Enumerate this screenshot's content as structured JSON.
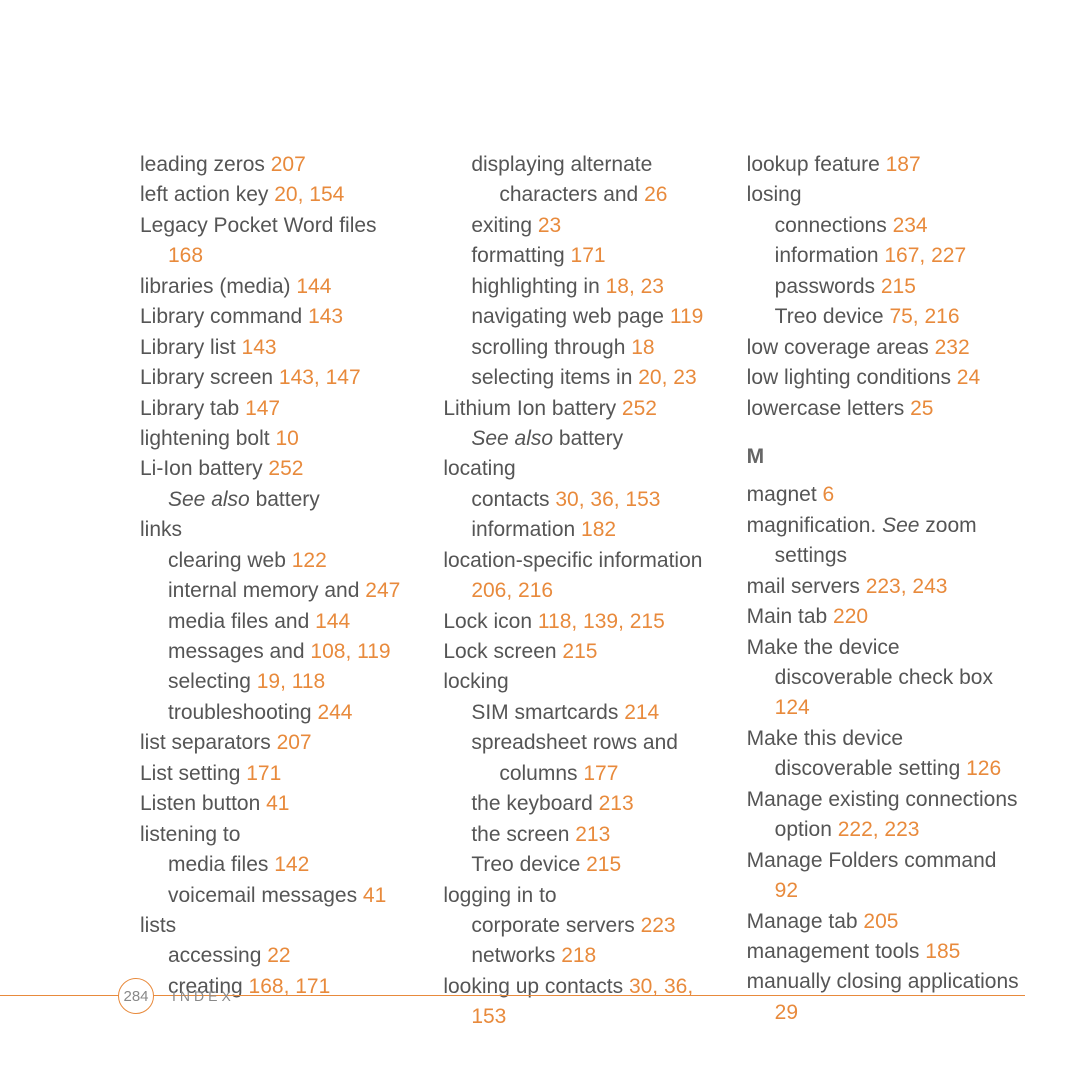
{
  "col1": {
    "e1": {
      "t": "leading zeros ",
      "p": "207"
    },
    "e2": {
      "t": "left action key ",
      "p": "20, 154"
    },
    "e3": {
      "t": "Legacy Pocket Word files"
    },
    "e3b": {
      "p": "168"
    },
    "e4": {
      "t": "libraries (media) ",
      "p": "144"
    },
    "e5": {
      "t": "Library command ",
      "p": "143"
    },
    "e6": {
      "t": "Library list ",
      "p": "143"
    },
    "e7": {
      "t": "Library screen ",
      "p": "143, 147"
    },
    "e8": {
      "t": "Library tab ",
      "p": "147"
    },
    "e9": {
      "t": "lightening bolt ",
      "p": "10"
    },
    "e10": {
      "t": "Li-Ion battery ",
      "p": "252"
    },
    "e10b": {
      "see": "See also",
      "t": " battery"
    },
    "e11": {
      "t": "links"
    },
    "e11a": {
      "t": "clearing web ",
      "p": "122"
    },
    "e11b": {
      "t": "internal memory and ",
      "p": "247"
    },
    "e11c": {
      "t": "media files and ",
      "p": "144"
    },
    "e11d": {
      "t": "messages and ",
      "p": "108, 119"
    },
    "e11e": {
      "t": "selecting ",
      "p": "19, 118"
    },
    "e11f": {
      "t": "troubleshooting ",
      "p": "244"
    },
    "e12": {
      "t": "list separators ",
      "p": "207"
    },
    "e13": {
      "t": "List setting ",
      "p": "171"
    },
    "e14": {
      "t": "Listen button ",
      "p": "41"
    },
    "e15": {
      "t": "listening to"
    },
    "e15a": {
      "t": "media files ",
      "p": "142"
    },
    "e15b": {
      "t": "voicemail messages ",
      "p": "41"
    },
    "e16": {
      "t": "lists"
    },
    "e16a": {
      "t": "accessing ",
      "p": "22"
    },
    "e16b": {
      "t": "creating ",
      "p": "168, 171"
    }
  },
  "col2": {
    "e1": {
      "t": "displaying alternate"
    },
    "e1b": {
      "t": "characters and ",
      "p": "26"
    },
    "e2": {
      "t": "exiting ",
      "p": "23"
    },
    "e3": {
      "t": "formatting ",
      "p": "171"
    },
    "e4": {
      "t": "highlighting in ",
      "p": "18, 23"
    },
    "e5": {
      "t": "navigating web page ",
      "p": "119"
    },
    "e6": {
      "t": "scrolling through ",
      "p": "18"
    },
    "e7": {
      "t": "selecting items in ",
      "p": "20, 23"
    },
    "e8": {
      "t": "Lithium Ion battery ",
      "p": "252"
    },
    "e8b": {
      "see": "See also",
      "t": " battery"
    },
    "e9": {
      "t": "locating"
    },
    "e9a": {
      "t": "contacts ",
      "p": "30, 36, 153"
    },
    "e9b": {
      "t": "information ",
      "p": "182"
    },
    "e10": {
      "t": "location-specific information"
    },
    "e10b": {
      "p": "206, 216"
    },
    "e11": {
      "t": "Lock icon ",
      "p": "118, 139, 215"
    },
    "e12": {
      "t": "Lock screen ",
      "p": "215"
    },
    "e13": {
      "t": "locking"
    },
    "e13a": {
      "t": "SIM smartcards ",
      "p": "214"
    },
    "e13b": {
      "t": "spreadsheet rows and"
    },
    "e13b2": {
      "t": "columns ",
      "p": "177"
    },
    "e13c": {
      "t": "the keyboard ",
      "p": "213"
    },
    "e13d": {
      "t": "the screen ",
      "p": "213"
    },
    "e13e": {
      "t": "Treo device ",
      "p": "215"
    },
    "e14": {
      "t": "logging in to"
    },
    "e14a": {
      "t": "corporate servers ",
      "p": "223"
    },
    "e14b": {
      "t": "networks ",
      "p": "218"
    },
    "e15": {
      "t": "looking up contacts ",
      "p": "30, 36,"
    },
    "e15b": {
      "p": "153"
    }
  },
  "col3": {
    "e1": {
      "t": "lookup feature ",
      "p": "187"
    },
    "e2": {
      "t": "losing"
    },
    "e2a": {
      "t": "connections ",
      "p": "234"
    },
    "e2b": {
      "t": "information ",
      "p": "167, 227"
    },
    "e2c": {
      "t": "passwords ",
      "p": "215"
    },
    "e2d": {
      "t": "Treo device ",
      "p": "75, 216"
    },
    "e3": {
      "t": "low coverage areas ",
      "p": "232"
    },
    "e4": {
      "t": "low lighting conditions ",
      "p": "24"
    },
    "e5": {
      "t": "lowercase letters ",
      "p": "25"
    },
    "heading": "M",
    "m1": {
      "t": "magnet ",
      "p": "6"
    },
    "m2": {
      "t": "magnification. ",
      "see": "See",
      "t2": " zoom"
    },
    "m2b": {
      "t": "settings"
    },
    "m3": {
      "t": "mail servers ",
      "p": "223, 243"
    },
    "m4": {
      "t": "Main tab ",
      "p": "220"
    },
    "m5": {
      "t": "Make the device"
    },
    "m5b": {
      "t": "discoverable check box"
    },
    "m5c": {
      "p": "124"
    },
    "m6": {
      "t": "Make this device"
    },
    "m6b": {
      "t": "discoverable setting ",
      "p": "126"
    },
    "m7": {
      "t": "Manage existing connections"
    },
    "m7b": {
      "t": "option ",
      "p": "222, 223"
    },
    "m8": {
      "t": "Manage Folders command"
    },
    "m8b": {
      "p": "92"
    },
    "m9": {
      "t": "Manage tab ",
      "p": "205"
    },
    "m10": {
      "t": "management tools ",
      "p": "185"
    },
    "m11": {
      "t": "manually closing applications"
    },
    "m11b": {
      "p": "29"
    }
  },
  "footer": {
    "page": "284",
    "label": "INDEX"
  }
}
